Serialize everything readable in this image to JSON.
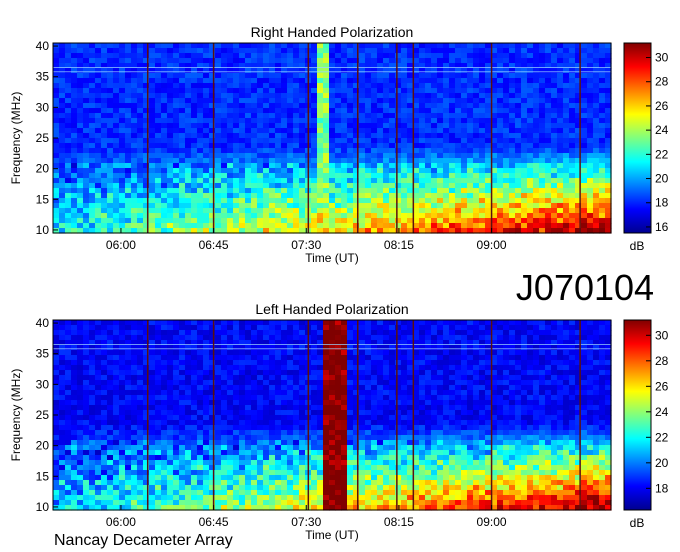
{
  "chart_data": [
    {
      "type": "heatmap",
      "title": "Right Handed Polarization",
      "xlabel": "Time (UT)",
      "ylabel": "Frequency (MHz)",
      "x_ticks": [
        "06:00",
        "06:45",
        "07:30",
        "08:15",
        "09:00"
      ],
      "y_ticks": [
        10,
        15,
        20,
        25,
        30,
        35,
        40
      ],
      "xlim": [
        "05:27",
        "09:58"
      ],
      "ylim": [
        9.5,
        40.5
      ],
      "colorbar": {
        "label": "dB",
        "ticks": [
          16,
          18,
          20,
          22,
          24,
          26,
          28,
          30
        ],
        "range": [
          15.5,
          31.2
        ]
      },
      "vertical_markers": [
        "06:13",
        "06:45",
        "07:31",
        "07:55",
        "08:14",
        "08:22",
        "09:00",
        "09:43"
      ],
      "bursts": [
        {
          "start": "07:35",
          "end": "07:40",
          "fmin": 10,
          "fmax": 40,
          "intensity": 22
        }
      ]
    },
    {
      "type": "heatmap",
      "title": "Left Handed Polarization",
      "xlabel": "Time (UT)",
      "ylabel": "Frequency (MHz)",
      "x_ticks": [
        "06:00",
        "06:45",
        "07:30",
        "08:15",
        "09:00"
      ],
      "y_ticks": [
        10,
        15,
        20,
        25,
        30,
        35,
        40
      ],
      "xlim": [
        "05:27",
        "09:58"
      ],
      "ylim": [
        9.5,
        40.5
      ],
      "colorbar": {
        "label": "dB",
        "ticks": [
          18,
          20,
          22,
          24,
          26,
          28,
          30
        ],
        "range": [
          16.3,
          31.2
        ]
      },
      "vertical_markers": [
        "06:13",
        "06:45",
        "07:31",
        "07:55",
        "08:14",
        "08:22",
        "09:00",
        "09:43"
      ],
      "bursts": [
        {
          "start": "07:37",
          "end": "07:50",
          "fmin": 10,
          "fmax": 40,
          "intensity": 30
        }
      ]
    }
  ],
  "event_id": "J070104",
  "instrument": "Nancay Decameter Array",
  "colors": {
    "low": "#00008f",
    "mid": "#7fff7f",
    "high": "#800000"
  }
}
